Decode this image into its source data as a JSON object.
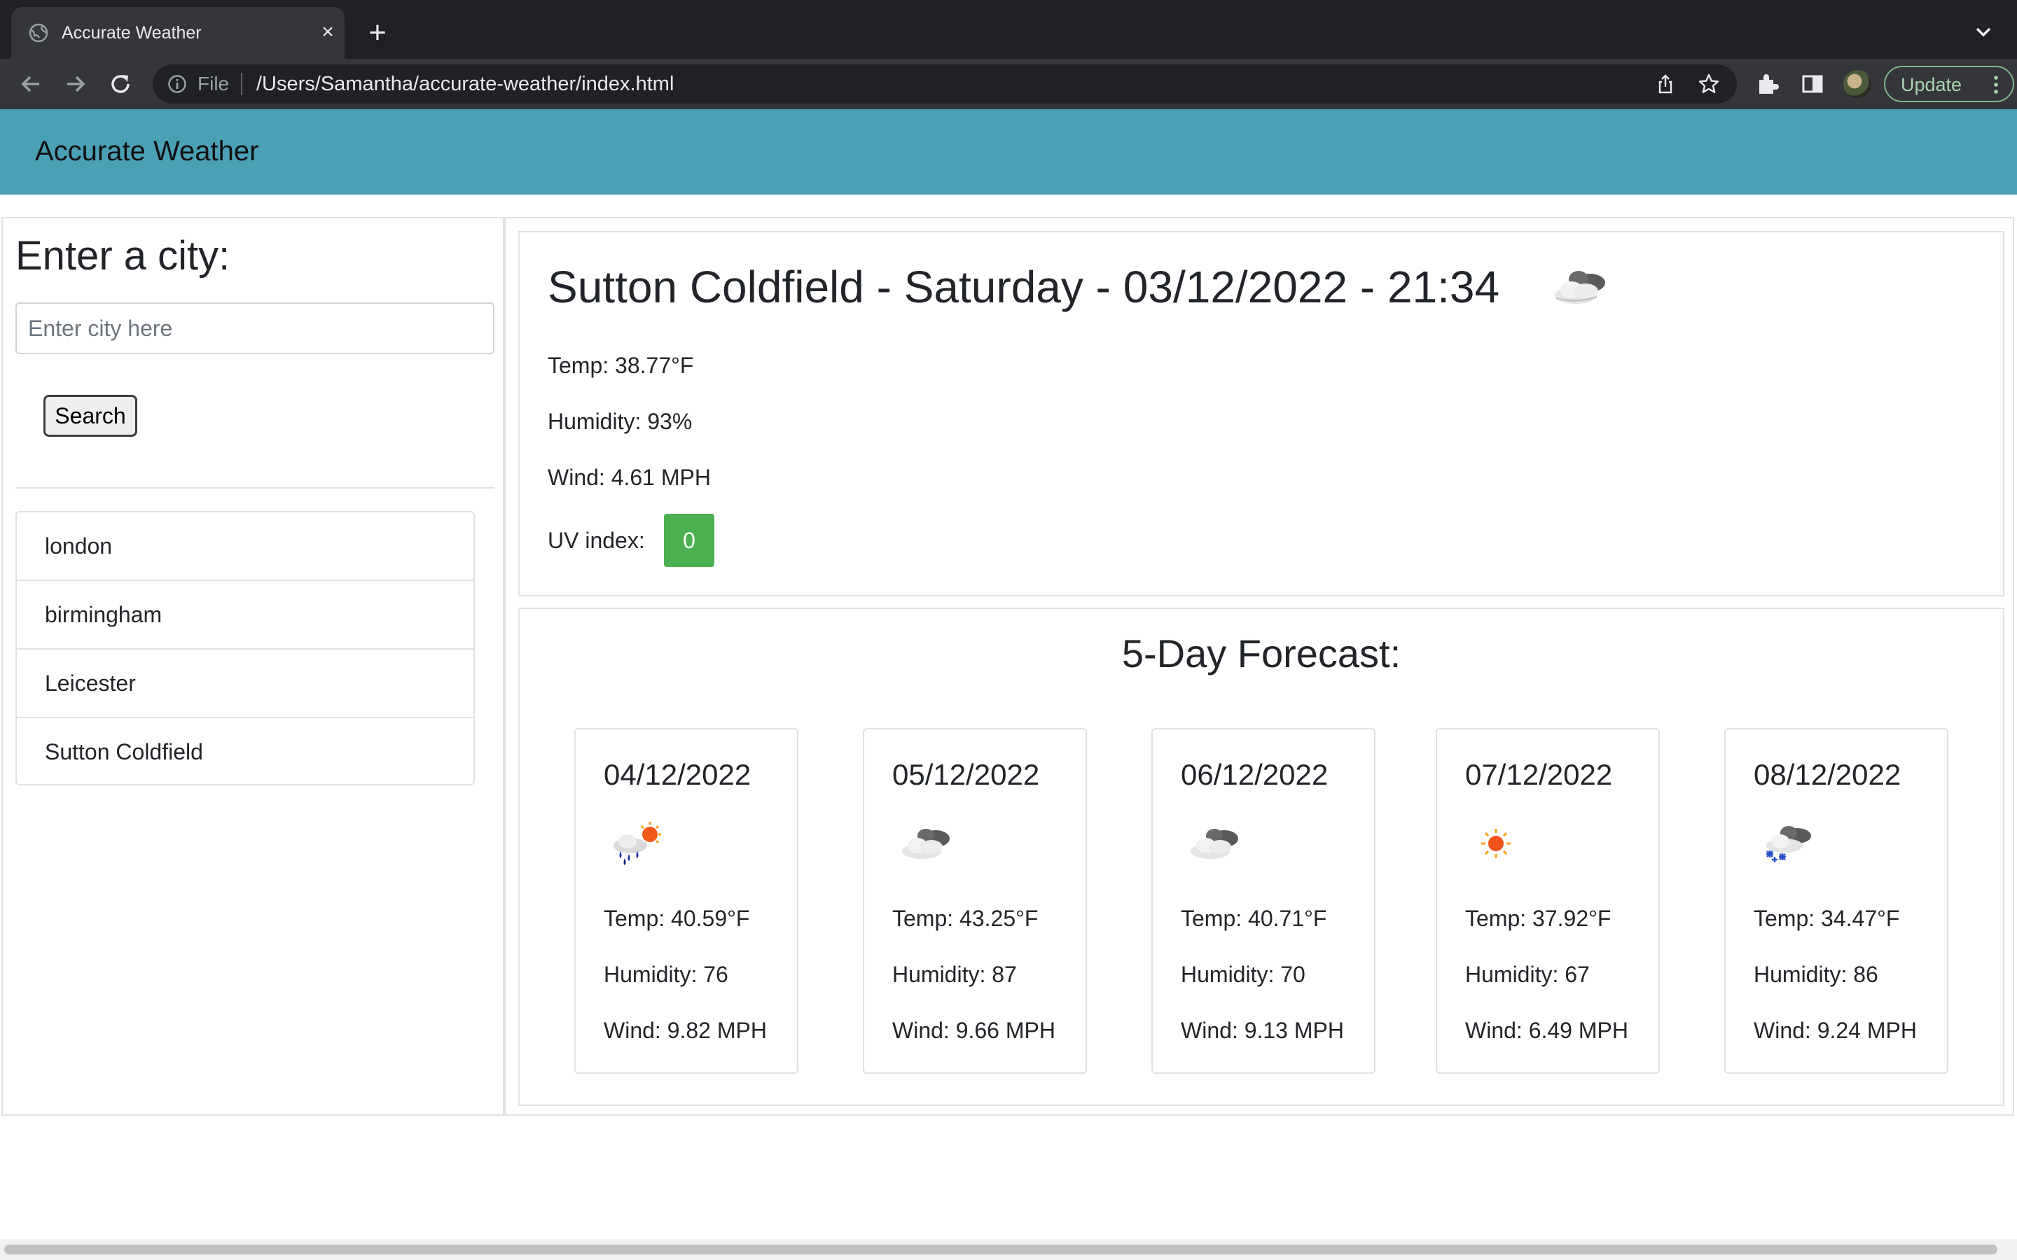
{
  "browser": {
    "tab_title": "Accurate Weather",
    "file_chip": "File",
    "url": "/Users/Samantha/accurate-weather/index.html",
    "update_label": "Update",
    "icons": [
      "globe-icon",
      "close-icon",
      "plus-icon",
      "chevron-down-icon",
      "back-arrow-icon",
      "forward-arrow-icon",
      "reload-icon",
      "info-icon",
      "share-icon",
      "star-icon",
      "extensions-icon",
      "side-panel-icon",
      "kebab-menu-icon"
    ]
  },
  "header": {
    "title": "Accurate Weather",
    "color": "#4aa0b5"
  },
  "search": {
    "heading": "Enter a city:",
    "placeholder": "Enter city here",
    "value": "",
    "button_label": "Search",
    "history": [
      "london",
      "birmingham",
      "Leicester",
      "Sutton Coldfield"
    ]
  },
  "current": {
    "heading": "Sutton Coldfield - Saturday - 03/12/2022 - 21:34",
    "icon": "cloudy-icon",
    "temp": "Temp: 38.77°F",
    "humidity": "Humidity: 93%",
    "wind": "Wind: 4.61 MPH",
    "uv_label": "UV index:",
    "uv_value": "0",
    "uv_color": "#4caf50"
  },
  "forecast": {
    "title": "5-Day Forecast:",
    "days": [
      {
        "date": "04/12/2022",
        "icon": "rain-sun-icon",
        "temp": "Temp: 40.59°F",
        "humidity": "Humidity: 76",
        "wind": "Wind: 9.82 MPH"
      },
      {
        "date": "05/12/2022",
        "icon": "cloudy-icon",
        "temp": "Temp: 43.25°F",
        "humidity": "Humidity: 87",
        "wind": "Wind: 9.66 MPH"
      },
      {
        "date": "06/12/2022",
        "icon": "cloudy-icon",
        "temp": "Temp: 40.71°F",
        "humidity": "Humidity: 70",
        "wind": "Wind: 9.13 MPH"
      },
      {
        "date": "07/12/2022",
        "icon": "sun-icon",
        "temp": "Temp: 37.92°F",
        "humidity": "Humidity: 67",
        "wind": "Wind: 6.49 MPH"
      },
      {
        "date": "08/12/2022",
        "icon": "snow-cloud-icon",
        "temp": "Temp: 34.47°F",
        "humidity": "Humidity: 86",
        "wind": "Wind: 9.24 MPH"
      }
    ]
  }
}
